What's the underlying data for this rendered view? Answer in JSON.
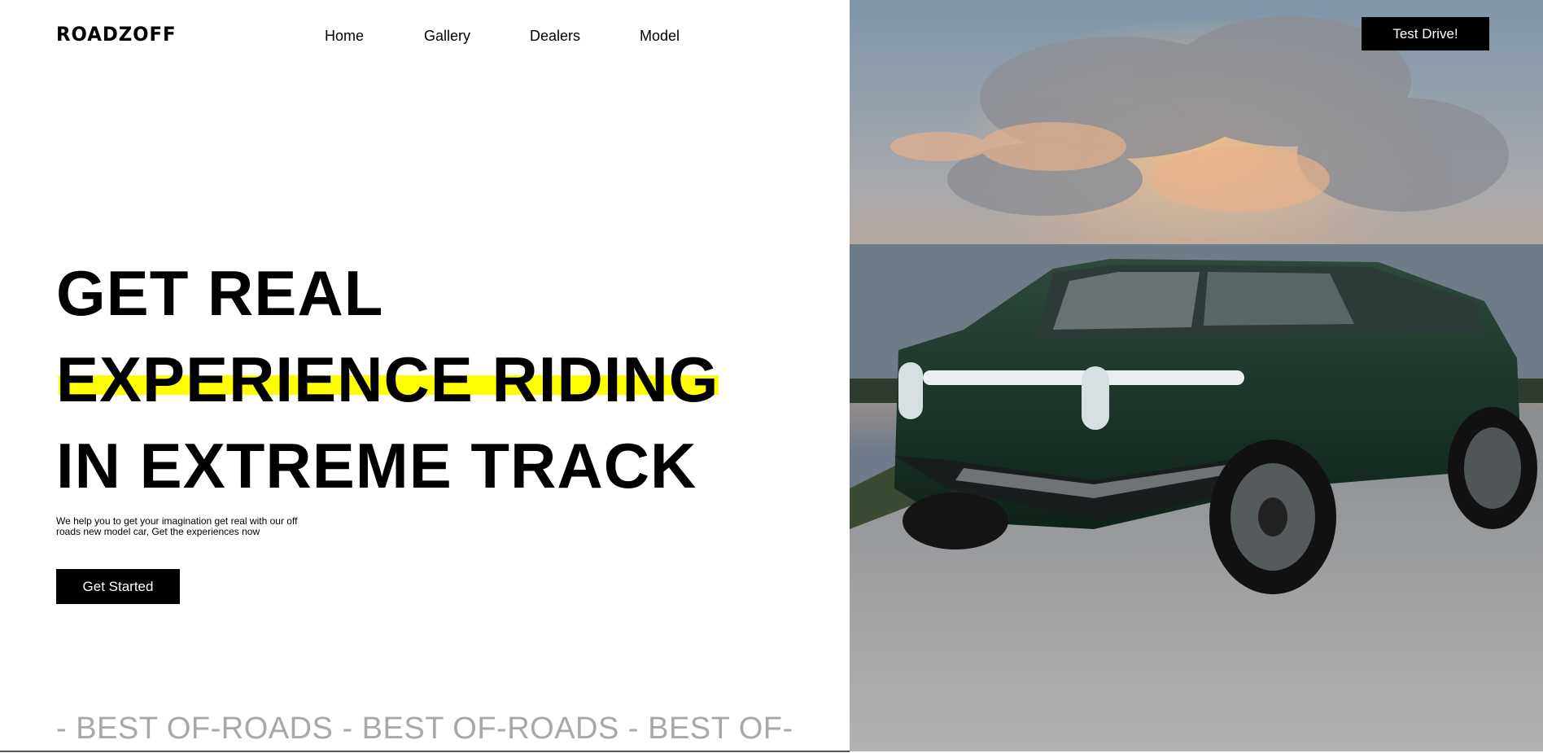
{
  "brand": {
    "logo_text": "ROADZOFF"
  },
  "nav": {
    "items": [
      "Home",
      "Gallery",
      "Dealers",
      "Model"
    ]
  },
  "hero": {
    "title_line1": "GET REAL",
    "title_line2": "EXPERIENCE RIDING",
    "title_line3": "IN EXTREME TRACK",
    "description": "We help you to get your imagination get real with our off roads new model car, Get the experiences now",
    "cta_label": "Get Started",
    "highlight_color": "#ffff00"
  },
  "header_cta": {
    "label": "Test Drive!"
  },
  "marquee": {
    "text": "- BEST OF-ROADS - BEST OF-ROADS - BEST OF-"
  },
  "image": {
    "subject": "dark green electric SUV on coastal road at sunset"
  }
}
